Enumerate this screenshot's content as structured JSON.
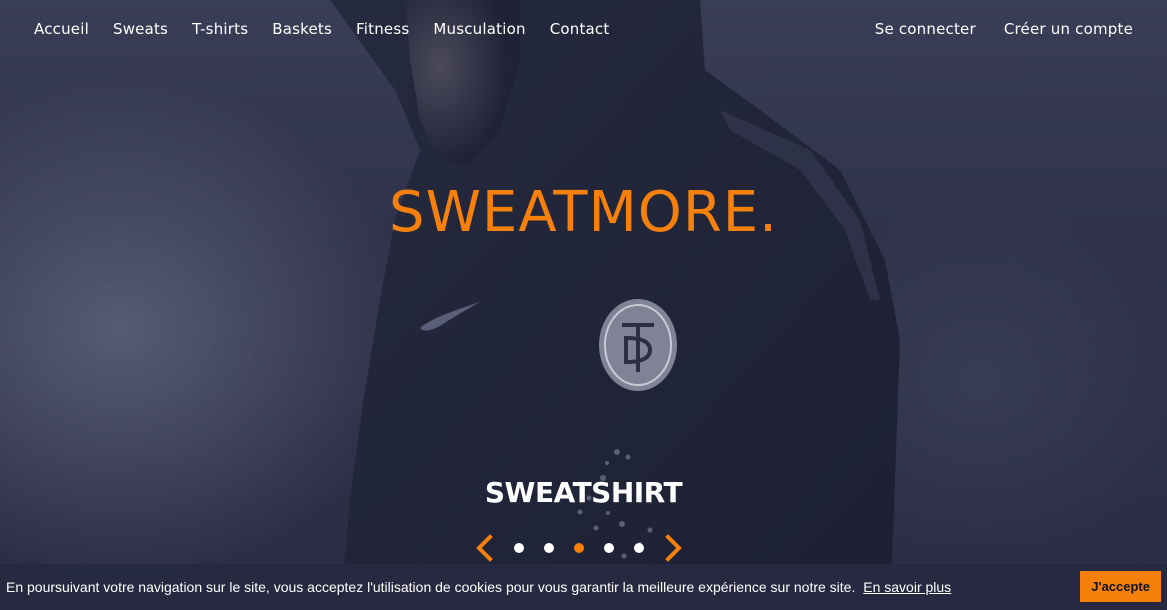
{
  "nav": {
    "left": [
      {
        "label": "Accueil"
      },
      {
        "label": "Sweats"
      },
      {
        "label": "T-shirts"
      },
      {
        "label": "Baskets"
      },
      {
        "label": "Fitness"
      },
      {
        "label": "Musculation"
      },
      {
        "label": "Contact"
      }
    ],
    "right": [
      {
        "label": "Se connecter"
      },
      {
        "label": "Créer un compte"
      }
    ]
  },
  "hero": {
    "headline": "SWEATMORE.",
    "slide_title": "SWEATSHIRT",
    "slide_count": 5,
    "active_slide_index": 2
  },
  "cookie": {
    "text": "En poursuivant votre navigation sur le site, vous acceptez l'utilisation de cookies pour vous garantir la meilleure expérience sur notre site.",
    "link": "En savoir plus",
    "accept_label": "J'accepte"
  },
  "colors": {
    "accent": "#f5800c",
    "background": "#2a2d44",
    "text": "#ffffff"
  }
}
